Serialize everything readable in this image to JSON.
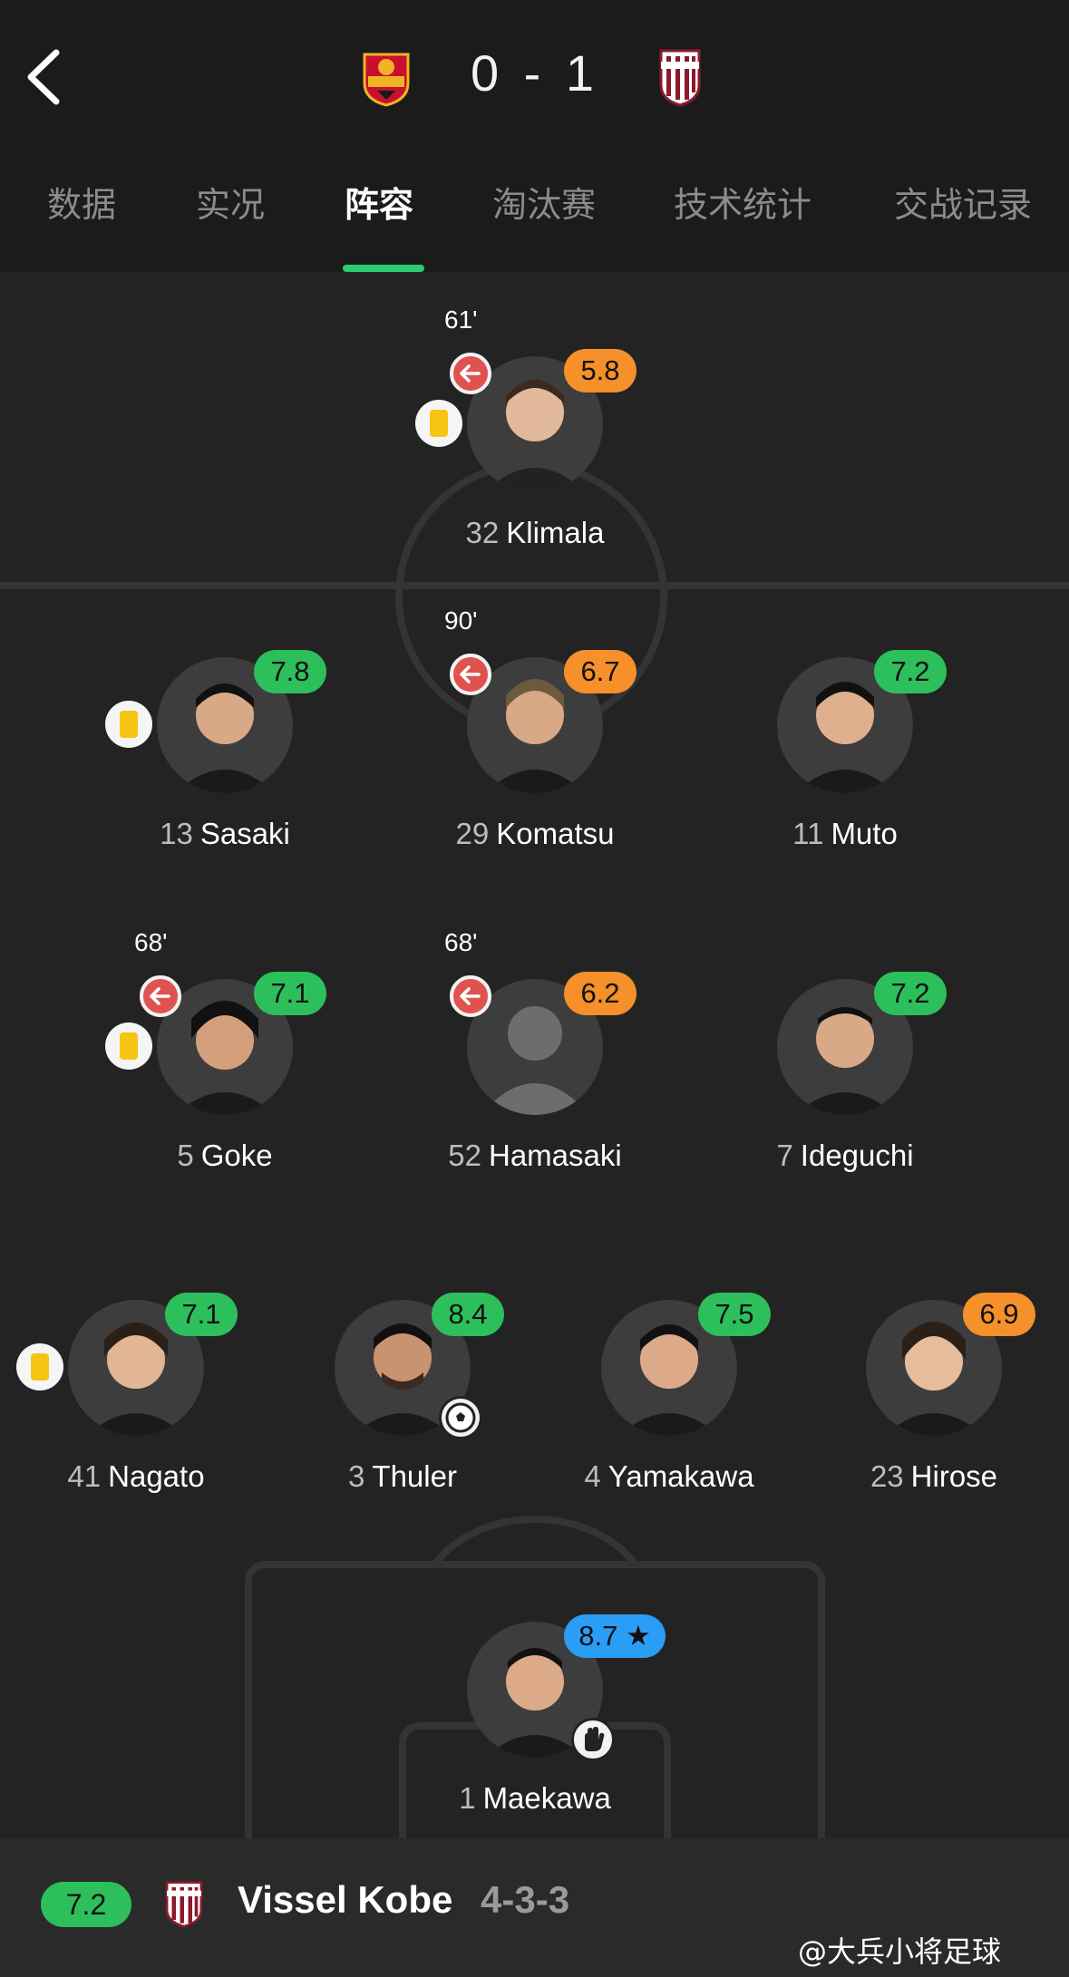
{
  "header": {
    "score": "0 - 1",
    "home_crest_icon": "fc-seoul-crest",
    "away_crest_icon": "vissel-kobe-crest"
  },
  "tabs": [
    {
      "label": "数据",
      "active": false
    },
    {
      "label": "实况",
      "active": false
    },
    {
      "label": "阵容",
      "active": true
    },
    {
      "label": "淘汰赛",
      "active": false
    },
    {
      "label": "技术统计",
      "active": false
    },
    {
      "label": "交战记录",
      "active": false
    }
  ],
  "players": {
    "klimala": {
      "number": "32",
      "name": "Klimala",
      "rating": "5.8",
      "rating_color": "orange",
      "sub_time": "61'",
      "subbed": true,
      "yellow_card": true
    },
    "sasaki": {
      "number": "13",
      "name": "Sasaki",
      "rating": "7.8",
      "rating_color": "green",
      "yellow_card": true
    },
    "komatsu": {
      "number": "29",
      "name": "Komatsu",
      "rating": "6.7",
      "rating_color": "orange",
      "sub_time": "90'",
      "subbed": true
    },
    "muto": {
      "number": "11",
      "name": "Muto",
      "rating": "7.2",
      "rating_color": "green"
    },
    "goke": {
      "number": "5",
      "name": "Goke",
      "rating": "7.1",
      "rating_color": "green",
      "sub_time": "68'",
      "subbed": true,
      "yellow_card": true
    },
    "hamasaki": {
      "number": "52",
      "name": "Hamasaki",
      "rating": "6.2",
      "rating_color": "orange",
      "sub_time": "68'",
      "subbed": true
    },
    "ideguchi": {
      "number": "7",
      "name": "Ideguchi",
      "rating": "7.2",
      "rating_color": "green"
    },
    "nagato": {
      "number": "41",
      "name": "Nagato",
      "rating": "7.1",
      "rating_color": "green",
      "yellow_card": true
    },
    "thuler": {
      "number": "3",
      "name": "Thuler",
      "rating": "8.4",
      "rating_color": "green",
      "event_icon": "goal-ball-icon"
    },
    "yamakawa": {
      "number": "4",
      "name": "Yamakawa",
      "rating": "7.5",
      "rating_color": "green"
    },
    "hirose": {
      "number": "23",
      "name": "Hirose",
      "rating": "6.9",
      "rating_color": "orange"
    },
    "maekawa": {
      "number": "1",
      "name": "Maekawa",
      "rating": "8.7 ★",
      "rating_color": "blue",
      "event_icon": "goalkeeper-glove-icon"
    }
  },
  "footer": {
    "team_rating": "7.2",
    "team_name": "Vissel Kobe",
    "formation": "4-3-3"
  },
  "watermark": "@大兵小将足球",
  "colors": {
    "accent_green": "#2cbf5b",
    "rating_orange": "#f5902a",
    "rating_blue": "#2a9df4",
    "sub_red": "#e0524f",
    "yellow_card": "#f6c514"
  }
}
